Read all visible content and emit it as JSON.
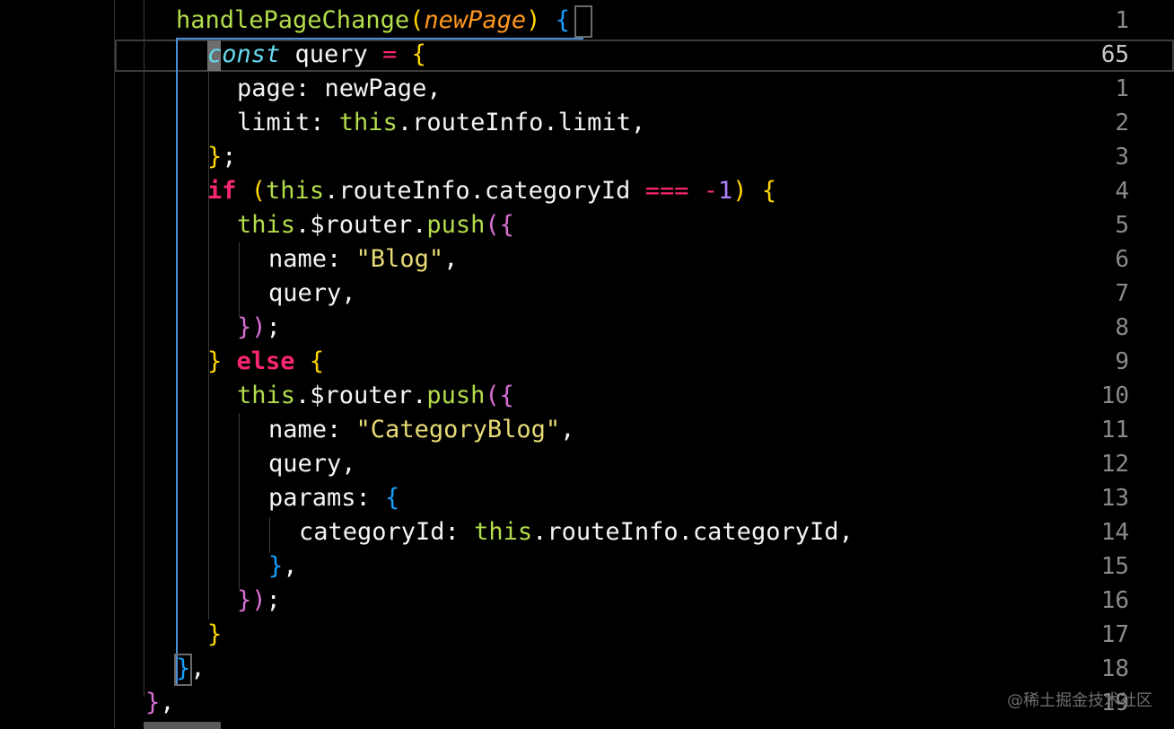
{
  "editor": {
    "line_numbers": [
      "1",
      "65",
      "1",
      "2",
      "3",
      "4",
      "5",
      "6",
      "7",
      "8",
      "9",
      "10",
      "11",
      "12",
      "13",
      "14",
      "15",
      "16",
      "17",
      "18",
      "19"
    ],
    "lines": [
      {
        "segments": [
          {
            "t": "handlePageChange",
            "c": "tk-fn"
          },
          {
            "t": "(",
            "c": "tk-b1"
          },
          {
            "t": "newPage",
            "c": "tk-param"
          },
          {
            "t": ")",
            "c": "tk-b1"
          },
          {
            "t": " ",
            "c": "plain"
          },
          {
            "t": "{",
            "c": "tk-b3"
          }
        ]
      },
      {
        "segments": [
          {
            "t": "const",
            "c": "tk-kw"
          },
          {
            "t": " query ",
            "c": "plain"
          },
          {
            "t": "=",
            "c": "tk-op"
          },
          {
            "t": " ",
            "c": "plain"
          },
          {
            "t": "{",
            "c": "tk-b1"
          }
        ]
      },
      {
        "segments": [
          {
            "t": "page: newPage,",
            "c": "plain"
          }
        ]
      },
      {
        "segments": [
          {
            "t": "limit: ",
            "c": "plain"
          },
          {
            "t": "this",
            "c": "tk-this"
          },
          {
            "t": ".routeInfo.limit,",
            "c": "plain"
          }
        ]
      },
      {
        "segments": [
          {
            "t": "}",
            "c": "tk-b1"
          },
          {
            "t": ";",
            "c": "plain"
          }
        ]
      },
      {
        "segments": [
          {
            "t": "if",
            "c": "tk-ctrl"
          },
          {
            "t": " ",
            "c": "plain"
          },
          {
            "t": "(",
            "c": "tk-b1"
          },
          {
            "t": "this",
            "c": "tk-this"
          },
          {
            "t": ".routeInfo.categoryId ",
            "c": "plain"
          },
          {
            "t": "===",
            "c": "tk-op"
          },
          {
            "t": " ",
            "c": "plain"
          },
          {
            "t": "-",
            "c": "tk-op"
          },
          {
            "t": "1",
            "c": "tk-num"
          },
          {
            "t": ")",
            "c": "tk-b1"
          },
          {
            "t": " ",
            "c": "plain"
          },
          {
            "t": "{",
            "c": "tk-b1"
          }
        ]
      },
      {
        "segments": [
          {
            "t": "this",
            "c": "tk-this"
          },
          {
            "t": ".$router.",
            "c": "plain"
          },
          {
            "t": "push",
            "c": "tk-fn"
          },
          {
            "t": "(",
            "c": "tk-b2"
          },
          {
            "t": "{",
            "c": "tk-b2"
          }
        ]
      },
      {
        "segments": [
          {
            "t": "name: ",
            "c": "plain"
          },
          {
            "t": "\"Blog\"",
            "c": "tk-str"
          },
          {
            "t": ",",
            "c": "plain"
          }
        ]
      },
      {
        "segments": [
          {
            "t": "query,",
            "c": "plain"
          }
        ]
      },
      {
        "segments": [
          {
            "t": "}",
            "c": "tk-b2"
          },
          {
            "t": ")",
            "c": "tk-b2"
          },
          {
            "t": ";",
            "c": "plain"
          }
        ]
      },
      {
        "segments": [
          {
            "t": "}",
            "c": "tk-b1"
          },
          {
            "t": " ",
            "c": "plain"
          },
          {
            "t": "else",
            "c": "tk-ctrl"
          },
          {
            "t": " ",
            "c": "plain"
          },
          {
            "t": "{",
            "c": "tk-b1"
          }
        ]
      },
      {
        "segments": [
          {
            "t": "this",
            "c": "tk-this"
          },
          {
            "t": ".$router.",
            "c": "plain"
          },
          {
            "t": "push",
            "c": "tk-fn"
          },
          {
            "t": "(",
            "c": "tk-b2"
          },
          {
            "t": "{",
            "c": "tk-b2"
          }
        ]
      },
      {
        "segments": [
          {
            "t": "name: ",
            "c": "plain"
          },
          {
            "t": "\"CategoryBlog\"",
            "c": "tk-str"
          },
          {
            "t": ",",
            "c": "plain"
          }
        ]
      },
      {
        "segments": [
          {
            "t": "query,",
            "c": "plain"
          }
        ]
      },
      {
        "segments": [
          {
            "t": "params: ",
            "c": "plain"
          },
          {
            "t": "{",
            "c": "tk-b3"
          }
        ]
      },
      {
        "segments": [
          {
            "t": "categoryId: ",
            "c": "plain"
          },
          {
            "t": "this",
            "c": "tk-this"
          },
          {
            "t": ".routeInfo.categoryId,",
            "c": "plain"
          }
        ]
      },
      {
        "segments": [
          {
            "t": "}",
            "c": "tk-b3"
          },
          {
            "t": ",",
            "c": "plain"
          }
        ]
      },
      {
        "segments": [
          {
            "t": "}",
            "c": "tk-b2"
          },
          {
            "t": ")",
            "c": "tk-b2"
          },
          {
            "t": ";",
            "c": "plain"
          }
        ]
      },
      {
        "segments": [
          {
            "t": "}",
            "c": "tk-b1"
          }
        ]
      },
      {
        "segments": [
          {
            "t": "}",
            "c": "tk-b3"
          },
          {
            "t": ",",
            "c": "plain"
          }
        ]
      },
      {
        "segments": [
          {
            "t": "}",
            "c": "tk-b2"
          },
          {
            "t": ",",
            "c": "plain"
          }
        ]
      }
    ]
  },
  "colors": {
    "background": "#000000",
    "function": "#b2dd4b",
    "keyword": "#66d9ef",
    "control": "#f92672",
    "string": "#e6db74",
    "number": "#ae81ff",
    "bracket_gold": "#ffd700",
    "bracket_orchid": "#da70d6",
    "bracket_blue": "#179fff"
  },
  "watermark": "@稀土掘金技术社区"
}
